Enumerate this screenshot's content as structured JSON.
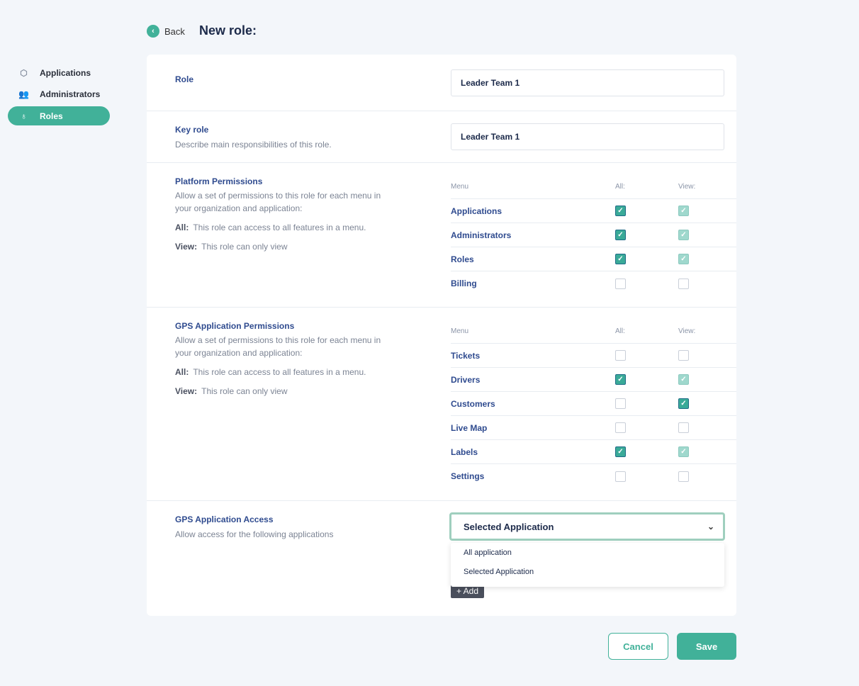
{
  "sidebar": {
    "items": [
      {
        "label": "Applications",
        "icon": "cube-icon"
      },
      {
        "label": "Administrators",
        "icon": "users-icon"
      },
      {
        "label": "Roles",
        "icon": "badge-icon",
        "active": true
      }
    ]
  },
  "header": {
    "back_label": "Back",
    "title": "New role:"
  },
  "role": {
    "label": "Role",
    "value": "Leader Team 1"
  },
  "key_role": {
    "label": "Key role",
    "description": "Describe main responsibilities of this role.",
    "value": "Leader Team 1"
  },
  "platform": {
    "label": "Platform Permissions",
    "description": "Allow a set of permissions to this role for each menu in your organization and application:",
    "all_key": "All:",
    "all_text": "This role can access to all features in a menu.",
    "view_key": "View:",
    "view_text": "This role can only view",
    "columns": [
      "Menu",
      "All:",
      "View:"
    ],
    "rows": [
      {
        "name": "Applications",
        "all": "checked",
        "view": "checked-muted"
      },
      {
        "name": "Administrators",
        "all": "checked",
        "view": "checked-muted"
      },
      {
        "name": "Roles",
        "all": "checked",
        "view": "checked-muted"
      },
      {
        "name": "Billing",
        "all": "unchecked",
        "view": "unchecked"
      }
    ]
  },
  "gps": {
    "label": "GPS Application Permissions",
    "description": "Allow a set of permissions to this role for each menu in your organization and application:",
    "all_key": "All:",
    "all_text": "This role can access to all features in a menu.",
    "view_key": "View:",
    "view_text": "This role can only view",
    "columns": [
      "Menu",
      "All:",
      "View:"
    ],
    "rows": [
      {
        "name": "Tickets",
        "all": "unchecked",
        "view": "unchecked"
      },
      {
        "name": "Drivers",
        "all": "checked",
        "view": "checked-muted"
      },
      {
        "name": "Customers",
        "all": "unchecked",
        "view": "checked"
      },
      {
        "name": "Live Map",
        "all": "unchecked",
        "view": "unchecked"
      },
      {
        "name": "Labels",
        "all": "checked",
        "view": "checked-muted"
      },
      {
        "name": "Settings",
        "all": "unchecked",
        "view": "unchecked"
      }
    ]
  },
  "access": {
    "label": "GPS Application Access",
    "description": "Allow access for the following applications",
    "selected": "Selected Application",
    "options": [
      "All application",
      "Selected Application"
    ],
    "add_label": "+ Add"
  },
  "footer": {
    "cancel_label": "Cancel",
    "save_label": "Save"
  },
  "colors": {
    "accent": "#41b199",
    "label": "#2f4b8f"
  }
}
